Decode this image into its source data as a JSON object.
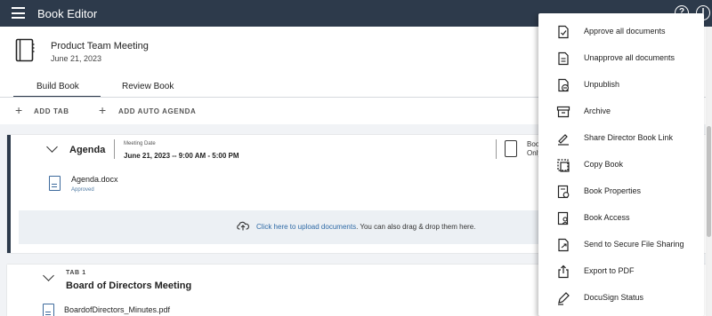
{
  "app": {
    "title": "Book Editor"
  },
  "book": {
    "title": "Product Team Meeting",
    "date": "June 21, 2023"
  },
  "tabs": [
    {
      "label": "Build Book",
      "active": true
    },
    {
      "label": "Review Book",
      "active": false
    }
  ],
  "actions": {
    "add_tab": "ADD TAB",
    "add_auto_agenda": "ADD AUTO AGENDA"
  },
  "agenda": {
    "title": "Agenda",
    "meeting_date_label": "Meeting Date",
    "meeting_date_value": "June 21, 2023 -- 9:00 AM - 5:00 PM",
    "book_only_line1": "Boo",
    "book_only_line2": "Only",
    "document": {
      "name": "Agenda.docx",
      "status": "Approved"
    },
    "upload": {
      "link_text": "Click here to upload documents",
      "rest_text": ". You can also drag & drop them here."
    }
  },
  "tab1": {
    "label": "TAB 1",
    "title": "Board of Directors Meeting",
    "document": {
      "name": "BoardofDirectors_Minutes.pdf"
    }
  },
  "menu": {
    "items": [
      {
        "label": "Approve all documents",
        "icon": "approve-documents-icon"
      },
      {
        "label": "Unapprove all documents",
        "icon": "unapprove-documents-icon"
      },
      {
        "label": "Unpublish",
        "icon": "unpublish-icon"
      },
      {
        "label": "Archive",
        "icon": "archive-icon"
      },
      {
        "label": "Share Director Book Link",
        "icon": "share-link-icon"
      },
      {
        "label": "Copy Book",
        "icon": "copy-book-icon"
      },
      {
        "label": "Book Properties",
        "icon": "book-properties-icon"
      },
      {
        "label": "Book Access",
        "icon": "book-access-icon"
      },
      {
        "label": "Send to Secure File Sharing",
        "icon": "secure-file-sharing-icon"
      },
      {
        "label": "Export to PDF",
        "icon": "export-pdf-icon"
      },
      {
        "label": "DocuSign Status",
        "icon": "docusign-status-icon"
      }
    ]
  },
  "colors": {
    "topbar": "#2d3a4b",
    "link": "#2f6aa6",
    "approved": "#4f7aa3"
  }
}
